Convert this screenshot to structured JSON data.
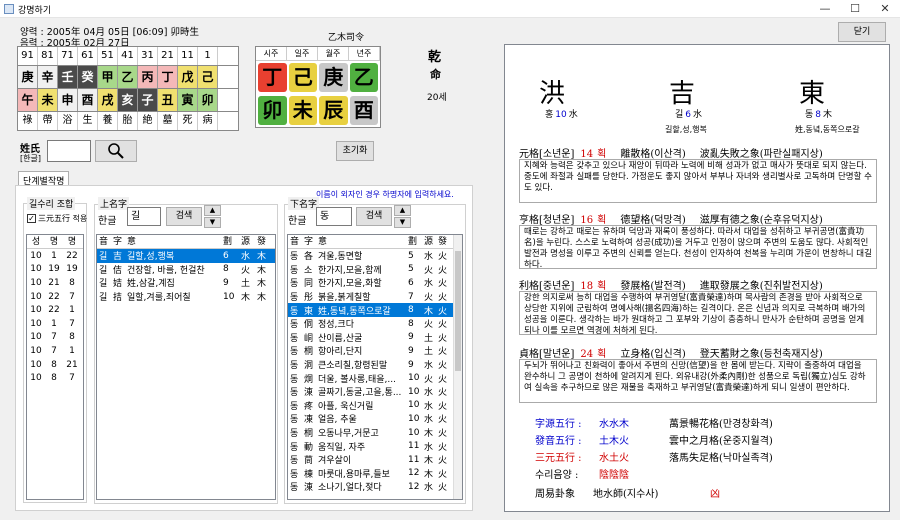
{
  "window": {
    "title": "강명하기",
    "min": "—",
    "max": "☐",
    "close": "✕"
  },
  "birth": {
    "solar": "양력 : 2005年 04月 05日 [06:09] 卯時生",
    "lunar": "음력 : 2005年 02月 27日"
  },
  "daeun": {
    "numbers": [
      "91",
      "81",
      "71",
      "61",
      "51",
      "41",
      "31",
      "21",
      "11",
      "1"
    ],
    "stems": [
      "庚",
      "辛",
      "壬",
      "癸",
      "甲",
      "乙",
      "丙",
      "丁",
      "戊",
      "己"
    ],
    "branches": [
      "午",
      "未",
      "申",
      "酉",
      "戌",
      "亥",
      "子",
      "丑",
      "寅",
      "卯"
    ],
    "stages": [
      "祿",
      "帶",
      "浴",
      "生",
      "養",
      "胎",
      "絶",
      "墓",
      "死",
      "病"
    ],
    "stem_colors": [
      "#f0f0f0",
      "#f0f0f0",
      "#4a4a4a",
      "#4a4a4a",
      "#a8d88a",
      "#a8d88a",
      "#f4b8b8",
      "#f4b8b8",
      "#f0e070",
      "#f0e070"
    ],
    "branch_colors": [
      "#f4b8b8",
      "#f0e070",
      "#f0f0f0",
      "#f0f0f0",
      "#f0e070",
      "#4a4a4a",
      "#4a4a4a",
      "#f0e070",
      "#a8d88a",
      "#a8d88a"
    ],
    "stem_text_colors": [
      "#000",
      "#000",
      "#fff",
      "#fff",
      "#000",
      "#000",
      "#000",
      "#000",
      "#000",
      "#000"
    ],
    "branch_text_colors": [
      "#000",
      "#000",
      "#000",
      "#000",
      "#000",
      "#fff",
      "#fff",
      "#000",
      "#000",
      "#000"
    ]
  },
  "saju": {
    "title": "乙木司令",
    "headers": [
      "시주",
      "일주",
      "월주",
      "년주"
    ],
    "stems": [
      "丁",
      "己",
      "庚",
      "乙"
    ],
    "branches": [
      "卯",
      "未",
      "辰",
      "酉"
    ],
    "stem_colors": [
      "#e84030",
      "#e8d040",
      "#c8c8c8",
      "#50b040"
    ],
    "branch_colors": [
      "#50b040",
      "#e8d040",
      "#e8d040",
      "#c8c8c8"
    ],
    "gender_top": "乾",
    "gender_bot": "命",
    "age": "20세"
  },
  "surname": {
    "label": "姓氏",
    "sub": "[한글]",
    "value": "",
    "reset": "초기화"
  },
  "close_btn": "닫기",
  "tab": "단계별작명",
  "suri": {
    "title": "길수리 조합",
    "checkbox": "三元五行 적용",
    "headers": [
      "성",
      "명",
      "명"
    ],
    "rows": [
      [
        "10",
        "1",
        "22"
      ],
      [
        "10",
        "19",
        "19"
      ],
      [
        "10",
        "21",
        "8"
      ],
      [
        "10",
        "22",
        "7"
      ],
      [
        "10",
        "22",
        "1"
      ],
      [
        "10",
        "1",
        "7"
      ],
      [
        "10",
        "7",
        "8"
      ],
      [
        "10",
        "7",
        "1"
      ],
      [
        "10",
        "8",
        "21"
      ],
      [
        "10",
        "8",
        "7"
      ]
    ]
  },
  "upper": {
    "title": "上名字",
    "hangul_label": "한글",
    "value": "길",
    "search": "검색",
    "headers": [
      "音",
      "字",
      "意",
      "劃",
      "源",
      "發"
    ],
    "rows": [
      [
        "길",
        "吉",
        "길할,성,행복",
        "6",
        "水",
        "木"
      ],
      [
        "길",
        "佶",
        "건장할, 바를, 헌걸찬",
        "8",
        "火",
        "木"
      ],
      [
        "길",
        "姞",
        "姓,삼갈,계집",
        "9",
        "土",
        "木"
      ],
      [
        "길",
        "拮",
        "일할,겨룰,죄어칠",
        "10",
        "木",
        "木"
      ]
    ],
    "selected": 0
  },
  "lower": {
    "title": "下名字",
    "hint": "이름이 외자인 경우 하명자에 입력하세요.",
    "hangul_label": "한글",
    "value": "동",
    "search": "검색",
    "headers": [
      "音",
      "字",
      "意",
      "劃",
      "源",
      "發"
    ],
    "rows": [
      [
        "동",
        "各",
        "겨울,동면할",
        "5",
        "水",
        "火"
      ],
      [
        "동",
        "소",
        "한가지,모을,함께",
        "5",
        "火",
        "火"
      ],
      [
        "동",
        "同",
        "한가지,모을,화할",
        "6",
        "水",
        "火"
      ],
      [
        "동",
        "彤",
        "붉을,붉게칠할",
        "7",
        "火",
        "火"
      ],
      [
        "동",
        "東",
        "姓,동녘,동쪽으로갈",
        "8",
        "木",
        "火"
      ],
      [
        "동",
        "侗",
        "정성,크다",
        "8",
        "火",
        "火"
      ],
      [
        "동",
        "峒",
        "산이름,산굴",
        "9",
        "土",
        "火"
      ],
      [
        "동",
        "桐",
        "항아리,단지",
        "9",
        "土",
        "火"
      ],
      [
        "동",
        "洞",
        "큰소리칠,항령된말",
        "9",
        "水",
        "火"
      ],
      [
        "동",
        "烔",
        "더울, 볼사롱,태을,...",
        "10",
        "火",
        "火"
      ],
      [
        "동",
        "涷",
        "골짜기,동굴,고을,통...",
        "10",
        "水",
        "火"
      ],
      [
        "동",
        "疼",
        "아플, 욱신거릴",
        "10",
        "水",
        "火"
      ],
      [
        "동",
        "凍",
        "얼음, 추울",
        "10",
        "水",
        "火"
      ],
      [
        "동",
        "桐",
        "오동나무,거문고",
        "10",
        "木",
        "火"
      ],
      [
        "동",
        "動",
        "움직일, 자주",
        "11",
        "水",
        "火"
      ],
      [
        "동",
        "茼",
        "겨우살이",
        "11",
        "木",
        "火"
      ],
      [
        "동",
        "棟",
        "마룻대,용마루,들보",
        "12",
        "木",
        "火"
      ],
      [
        "동",
        "涷",
        "소나기,얼다,젖다",
        "12",
        "水",
        "火"
      ]
    ],
    "selected": 4
  },
  "result": {
    "chars": [
      {
        "han": "洪",
        "hangul": "홍",
        "num": "10",
        "elem": "水",
        "meaning": ""
      },
      {
        "han": "吉",
        "hangul": "길",
        "num": "6",
        "elem": "水",
        "meaning": "길할,성,행복"
      },
      {
        "han": "東",
        "hangul": "동",
        "num": "8",
        "elem": "木",
        "meaning": "姓,동녘,동쪽으로갈"
      }
    ],
    "sections": [
      {
        "name": "元格[소년운]",
        "num": "14",
        "unit": "획",
        "a": "離散格(이산격)",
        "b": "波亂失敗之象(파란실패지상)",
        "text": "지혜와 능력은 갖추고 있으나 재앙이 뒤따라 노력에 비해 성과가 없고 매사가 뜻대로 되지 않는다. 중도에 좌절과 실패를 당한다. 가정운도 좋지 않아서 부부나 자녀와 생리별사로 고독하며 단명할 수도 있다."
      },
      {
        "name": "亨格[청년운]",
        "num": "16",
        "unit": "획",
        "a": "德望格(덕망격)",
        "b": "滋厚有德之象(순후유덕지상)",
        "text": "때로는 강하고 때로는 유하며 덕망과 재록이 풍성하다. 따라서 대업을 성취하고 부귀공명(富貴功名)을 누린다. 스스로 노력하여 성공(成功)을 거두고 인정이 많으며 주변의 도움도 많다. 사회적인 발전과 명성을 이루고 주변의 신뢰를 얻는다. 천성이 인자하여 천복을 누리며 가운이 번창하니 대길하다."
      },
      {
        "name": "利格[중년운]",
        "num": "18",
        "unit": "획",
        "a": "發展格(발전격)",
        "b": "進取發展之象(진취발전지상)",
        "text": "강한 의지로써 능히 대업을 수행하여 부귀영달(富貴榮達)하며 목사람의 존경을 받아 사회적으로 상당한 지위에 군림하여 명예사해(揚名四海)하는 길격이다. 온은 신념과 의지로 극복하며 배가의 성공을 이룬다. 생각하는 바가 원대하고 그 포부와 기상이 충충하니 만사가 순탄하며 공명을 얻게 되나 이를 모르면 역경에 처하게 된다."
      },
      {
        "name": "貞格[말년운]",
        "num": "24",
        "unit": "획",
        "a": "立身格(입신격)",
        "b": "登天蓄財之象(등천축재지상)",
        "text": "두뇌가 뛰어나고 친화력이 좋아서 주변의 신망(信望)을 한 몸에 받는다. 지략이 출중하여 대업을 완수하니 그 공명이 천하에 알려지게 된다. 외유내강(外柔內剛)한 성품으로 독립(獨立)심도 강하여 실속을 추구하므로 많은 재물을 축재하고 부귀영달(富貴榮達)하게 되니 일생이 편안하다."
      }
    ],
    "ohaeng": [
      {
        "label": "字源五行 :",
        "value": "水水木",
        "label_color": "#0000cc",
        "value_color": "#0000cc",
        "desc": "萬景暢花格(만경창화격)"
      },
      {
        "label": "發音五行 :",
        "value": "土木火",
        "label_color": "#0000cc",
        "value_color": "#0000cc",
        "desc": "雲中之月格(운중지월격)"
      },
      {
        "label": "三元五行 :",
        "value": "水土火",
        "label_color": "#d00000",
        "value_color": "#d00000",
        "desc": "落馬失足格(낙마실족격)"
      },
      {
        "label": "수리음양 :",
        "value": "陰陰陰",
        "label_color": "#000000",
        "value_color": "#d00000",
        "desc": ""
      }
    ],
    "gwae": {
      "label": "周易卦象",
      "value": "地水師(지수사)",
      "fortune": "凶"
    }
  }
}
